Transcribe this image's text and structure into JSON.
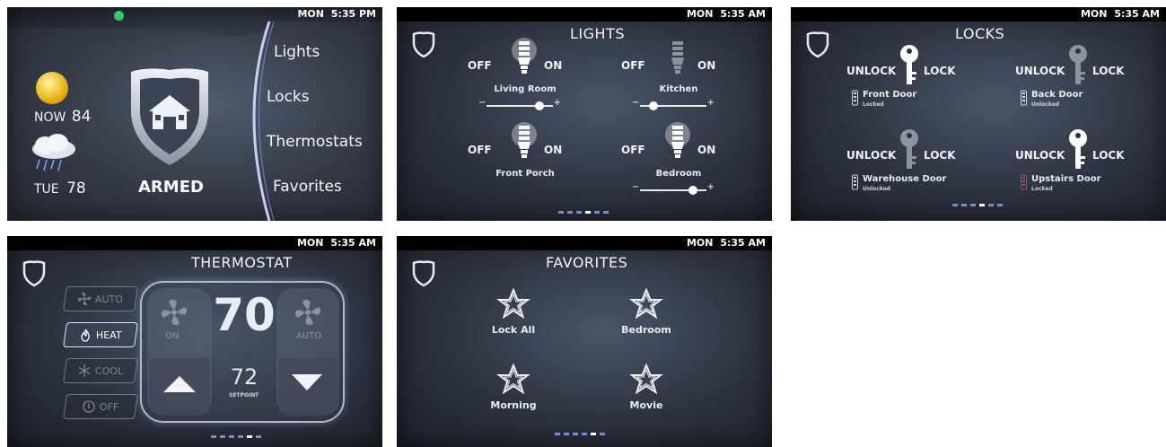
{
  "home": {
    "status": {
      "day": "MON",
      "time": "5:35 PM"
    },
    "weather_now": {
      "label": "NOW",
      "temp": "84"
    },
    "weather_next": {
      "label": "TUE",
      "temp": "78"
    },
    "security_state": "ARMED",
    "menu": [
      "Lights",
      "Locks",
      "Thermostats",
      "Favorites"
    ]
  },
  "lights": {
    "status": {
      "day": "MON",
      "time": "5:35 AM"
    },
    "title": "LIGHTS",
    "off_label": "OFF",
    "on_label": "ON",
    "items": [
      {
        "name": "Living Room",
        "lit": true,
        "has_slider": true,
        "level": 0.85
      },
      {
        "name": "Kitchen",
        "lit": false,
        "has_slider": true,
        "level": 0.15
      },
      {
        "name": "Front Porch",
        "lit": true,
        "has_slider": false
      },
      {
        "name": "Bedroom",
        "lit": true,
        "has_slider": true,
        "level": 0.85
      }
    ],
    "page_count": 6,
    "page_active": 3
  },
  "locks": {
    "status": {
      "day": "MON",
      "time": "5:35 AM"
    },
    "title": "LOCKS",
    "unlock_label": "UNLOCK",
    "lock_label": "LOCK",
    "items": [
      {
        "name": "Front Door",
        "state": "Locked",
        "key_bright": true
      },
      {
        "name": "Back Door",
        "state": "Unlocked",
        "key_bright": false
      },
      {
        "name": "Warehouse Door",
        "state": "Unlocked",
        "key_bright": false
      },
      {
        "name": "Upstairs Door",
        "state": "Locked",
        "key_bright": true
      }
    ],
    "page_count": 6,
    "page_active": 3
  },
  "thermostat": {
    "status": {
      "day": "MON",
      "time": "5:35 AM"
    },
    "title": "THERMOSTAT",
    "modes": [
      {
        "label": "AUTO",
        "icon": "fan-icon",
        "active": false
      },
      {
        "label": "HEAT",
        "icon": "flame-icon",
        "active": true
      },
      {
        "label": "COOL",
        "icon": "snowflake-icon",
        "active": false
      },
      {
        "label": "OFF",
        "icon": "power-icon",
        "active": false
      }
    ],
    "current_temp": "70",
    "setpoint": "72",
    "setpoint_label": "SETPOINT",
    "fan_left_label": "ON",
    "fan_right_label": "AUTO",
    "page_count": 6,
    "page_active": 4
  },
  "favorites": {
    "status": {
      "day": "MON",
      "time": "5:35 AM"
    },
    "title": "FAVORITES",
    "items": [
      "Lock All",
      "Bedroom",
      "Morning",
      "Movie"
    ],
    "page_count": 6,
    "page_active": 4
  },
  "colors": {
    "accent_dots": "#7b8bd0",
    "status_green": "#2ecc71",
    "battery_red": "#e0304a"
  }
}
